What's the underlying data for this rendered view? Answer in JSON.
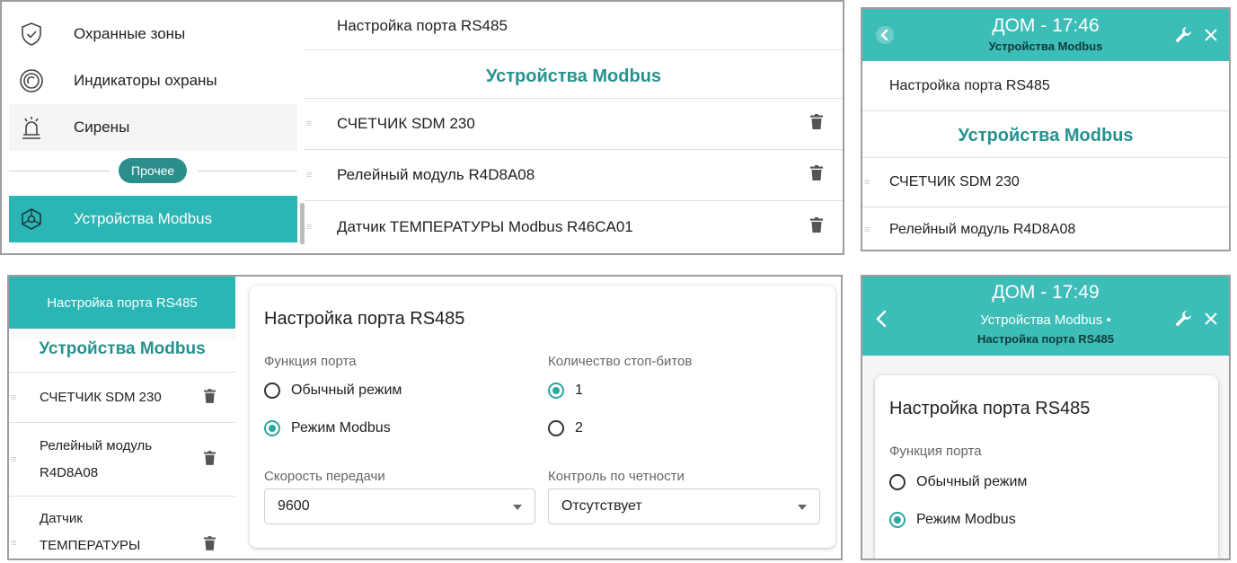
{
  "panel_a": {
    "sidebar": {
      "items": [
        {
          "label": "Охранные зоны"
        },
        {
          "label": "Индикаторы охраны"
        },
        {
          "label": "Сирены"
        }
      ],
      "section_chip": "Прочее",
      "active_item": "Устройства Modbus"
    },
    "list": {
      "top_item": "Настройка порта RS485",
      "section_title": "Устройства Modbus",
      "devices": [
        "СЧЕТЧИК SDM 230",
        "Релейный модуль R4D8A08",
        "Датчик ТЕМПЕРАТУРЫ Modbus R46CA01"
      ]
    }
  },
  "panel_b": {
    "header": {
      "title": "ДОМ - 17:46",
      "subtitle": "Устройства Modbus"
    },
    "list": {
      "top_item": "Настройка порта RS485",
      "section_title": "Устройства Modbus",
      "devices": [
        "СЧЕТЧИК SDM 230",
        "Релейный модуль R4D8A08"
      ]
    }
  },
  "panel_c": {
    "sidebar": {
      "active_item": "Настройка порта RS485",
      "section_title": "Устройства Modbus",
      "devices": [
        {
          "line1": "СЧЕТЧИК SDM 230",
          "line2": ""
        },
        {
          "line1": "Релейный модуль",
          "line2": "R4D8A08"
        },
        {
          "line1": "Датчик",
          "line2": "ТЕМПЕРАТУРЫ"
        }
      ]
    },
    "form": {
      "title": "Настройка порта RS485",
      "port_function": {
        "label": "Функция порта",
        "options": [
          "Обычный режим",
          "Режим Modbus"
        ],
        "selected": "Режим Modbus"
      },
      "stop_bits": {
        "label": "Количество стоп-битов",
        "options": [
          "1",
          "2"
        ],
        "selected": "1"
      },
      "baud_rate": {
        "label": "Скорость передачи",
        "value": "9600"
      },
      "parity": {
        "label": "Контроль по четности",
        "value": "Отсутствует"
      }
    }
  },
  "panel_d": {
    "header": {
      "title": "ДОМ - 17:49",
      "subtitle": "Устройства Modbus •",
      "subtitle2": "Настройка порта RS485"
    },
    "form": {
      "title": "Настройка порта RS485",
      "port_function": {
        "label": "Функция порта",
        "options": [
          "Обычный режим",
          "Режим Modbus"
        ],
        "selected": "Режим Modbus"
      }
    }
  },
  "colors": {
    "accent": "#3cbdb7",
    "active_sidebar": "#2bb5b5",
    "section_title": "#26928e",
    "chip": "#2a8e8a",
    "radio_on": "#2aa7a1"
  },
  "icons": [
    "shield-check-icon",
    "signal-rings-icon",
    "siren-icon",
    "modbus-network-icon",
    "trash-icon",
    "drag-handle-icon",
    "back-icon",
    "wrench-icon",
    "close-icon",
    "dropdown-caret-icon"
  ]
}
